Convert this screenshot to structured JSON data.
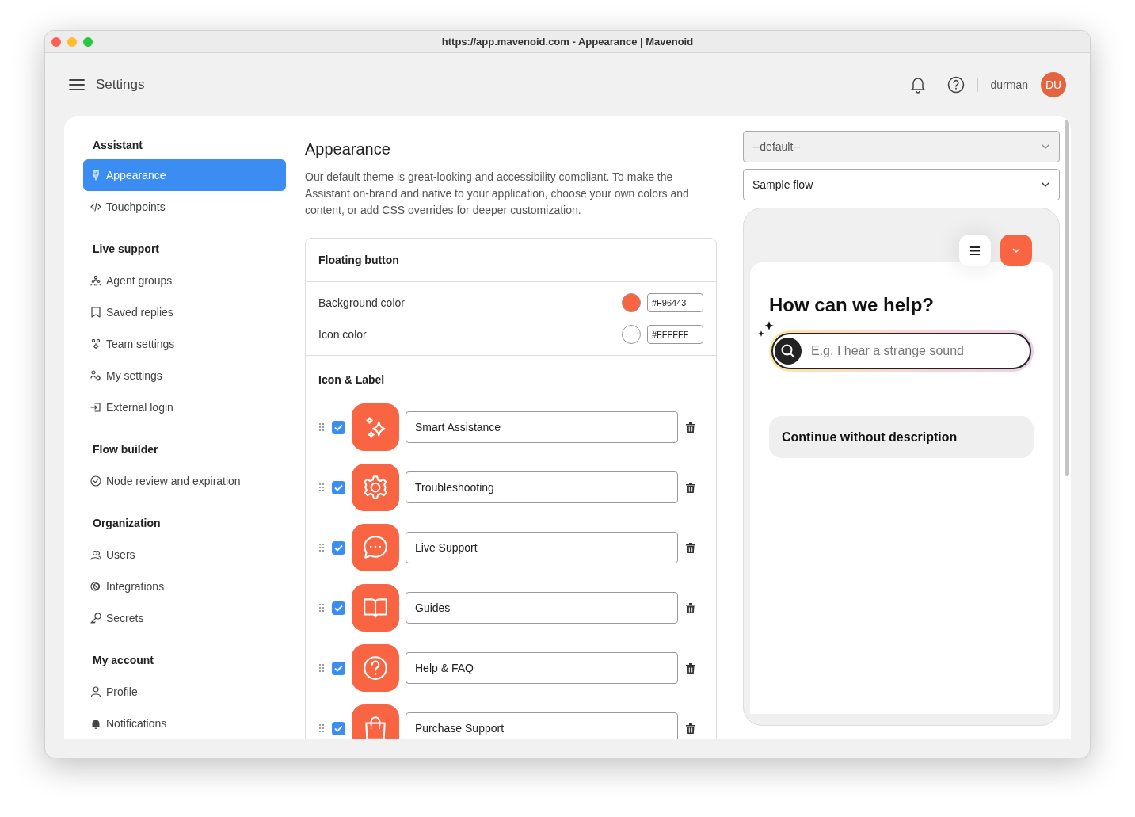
{
  "browser": {
    "title": "https://app.mavenoid.com - Appearance | Mavenoid"
  },
  "header": {
    "title": "Settings",
    "username": "durman",
    "avatar": "DU"
  },
  "sidebar": {
    "sections": [
      {
        "heading": "Assistant",
        "items": [
          {
            "label": "Appearance",
            "kind": "brush",
            "selected": true
          },
          {
            "label": "Touchpoints",
            "kind": "code",
            "selected": false
          }
        ]
      },
      {
        "heading": "Live support",
        "items": [
          {
            "label": "Agent groups",
            "kind": "group",
            "selected": false
          },
          {
            "label": "Saved replies",
            "kind": "bookmark",
            "selected": false
          },
          {
            "label": "Team settings",
            "kind": "team",
            "selected": false
          },
          {
            "label": "My settings",
            "kind": "usergear",
            "selected": false
          },
          {
            "label": "External login",
            "kind": "login",
            "selected": false
          }
        ]
      },
      {
        "heading": "Flow builder",
        "items": [
          {
            "label": "Node review and expiration",
            "kind": "check",
            "selected": false
          }
        ]
      },
      {
        "heading": "Organization",
        "items": [
          {
            "label": "Users",
            "kind": "users",
            "selected": false
          },
          {
            "label": "Integrations",
            "kind": "rings",
            "selected": false
          },
          {
            "label": "Secrets",
            "kind": "key",
            "selected": false
          }
        ]
      },
      {
        "heading": "My account",
        "items": [
          {
            "label": "Profile",
            "kind": "user",
            "selected": false
          },
          {
            "label": "Notifications",
            "kind": "bell",
            "selected": false
          }
        ]
      }
    ]
  },
  "main": {
    "title": "Appearance",
    "description": "Our default theme is great-looking and accessibility compliant. To make the Assistant on-brand and native to your application, choose your own colors and content, or add CSS overrides for deeper customization.",
    "floating_button": {
      "title": "Floating button",
      "colors": [
        {
          "label": "Background color",
          "color": "#f96443",
          "value": "#F96443"
        },
        {
          "label": "Icon color",
          "color": "#ffffff",
          "value": "#FFFFFF"
        }
      ]
    },
    "icon_label": {
      "title": "Icon & Label",
      "items": [
        {
          "kind": "sparkles",
          "label": "Smart Assistance",
          "checked": true
        },
        {
          "kind": "gear",
          "label": "Troubleshooting",
          "checked": true
        },
        {
          "kind": "chat",
          "label": "Live Support",
          "checked": true
        },
        {
          "kind": "book",
          "label": "Guides",
          "checked": true
        },
        {
          "kind": "question",
          "label": "Help & FAQ",
          "checked": true
        },
        {
          "kind": "bag",
          "label": "Purchase Support",
          "checked": true
        }
      ]
    }
  },
  "preview": {
    "theme_select": {
      "value": "--default--",
      "disabled": true
    },
    "flow_select": {
      "value": "Sample flow",
      "disabled": false
    },
    "heading": "How can we help?",
    "search_placeholder": "E.g. I hear a strange sound",
    "continue_button": "Continue without description"
  }
}
